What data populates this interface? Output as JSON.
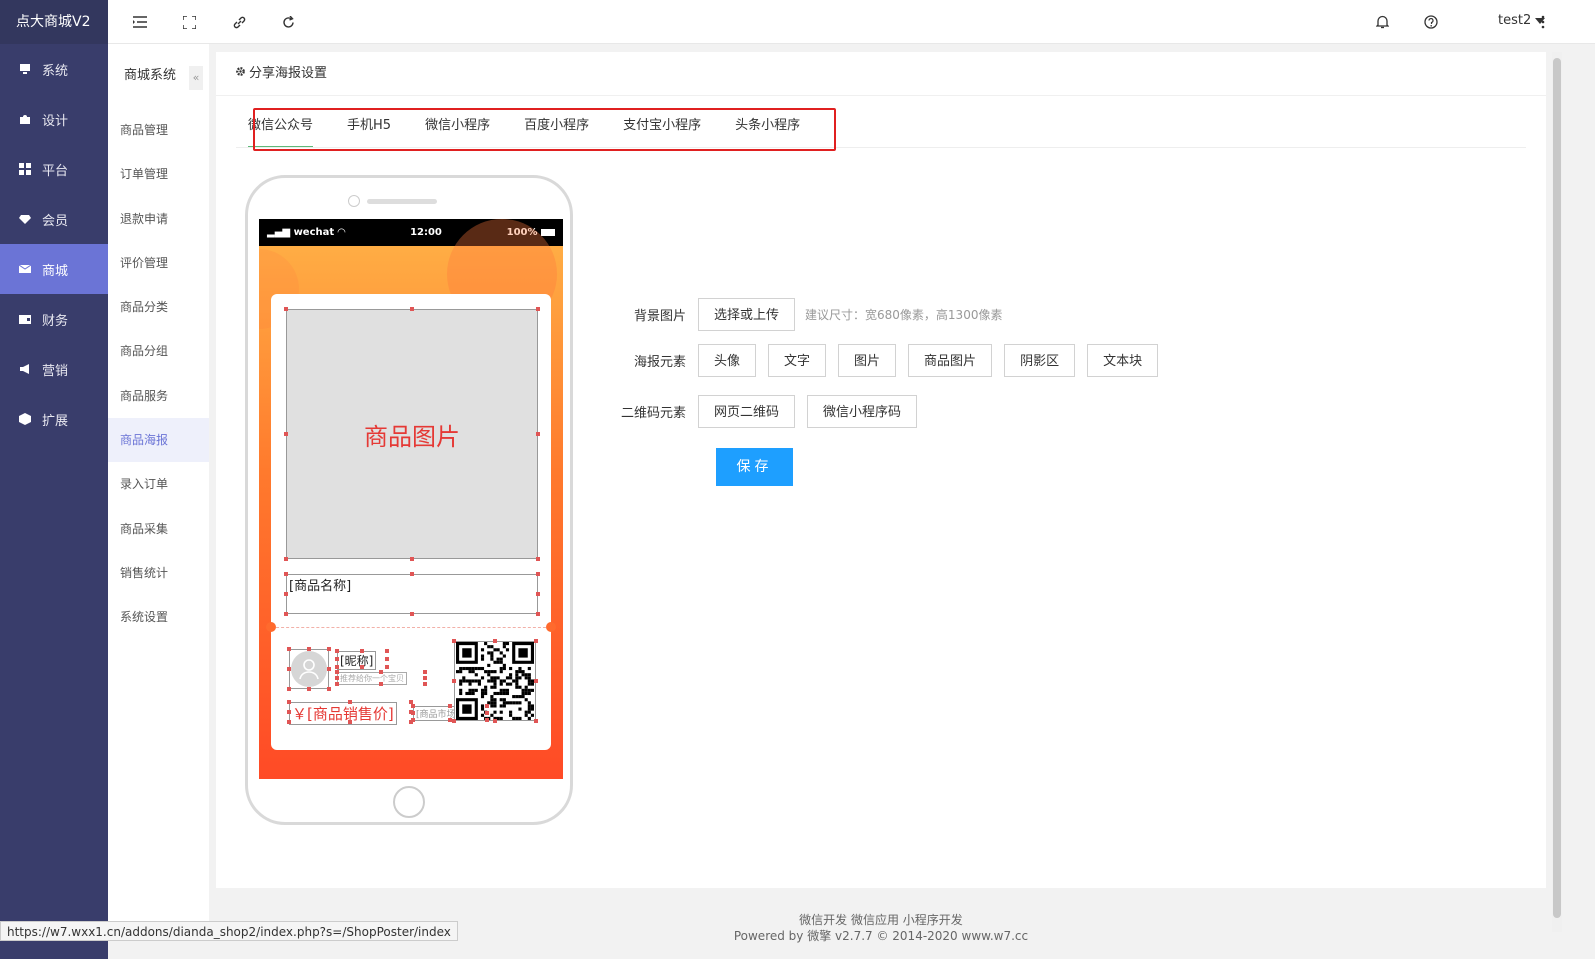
{
  "brand": "点大商城V2",
  "sidebar": {
    "items": [
      {
        "label": "系统",
        "icon": "monitor-icon"
      },
      {
        "label": "设计",
        "icon": "puzzle-icon"
      },
      {
        "label": "平台",
        "icon": "grid-icon"
      },
      {
        "label": "会员",
        "icon": "diamond-icon"
      },
      {
        "label": "商城",
        "icon": "mail-icon",
        "active": true
      },
      {
        "label": "财务",
        "icon": "wallet-icon"
      },
      {
        "label": "营销",
        "icon": "megaphone-icon"
      },
      {
        "label": "扩展",
        "icon": "cube-icon"
      }
    ]
  },
  "topbar": {
    "user": "test2"
  },
  "subnav": {
    "title": "商城系统",
    "collapse": "«",
    "items": [
      "商品管理",
      "订单管理",
      "退款申请",
      "评价管理",
      "商品分类",
      "商品分组",
      "商品服务",
      "商品海报",
      "录入订单",
      "商品采集",
      "销售统计",
      "系统设置"
    ],
    "active_index": 7
  },
  "panel": {
    "title": "分享海报设置",
    "tabs": [
      "微信公众号",
      "手机H5",
      "微信小程序",
      "百度小程序",
      "支付宝小程序",
      "头条小程序"
    ],
    "active_tab": 0
  },
  "phone": {
    "carrier": "wechat",
    "time": "12:00",
    "battery": "100%",
    "product_image": "商品图片",
    "product_name": "[商品名称]",
    "nickname": "[昵称]",
    "recommend": "推荐给你一个宝贝",
    "price": "￥[商品销售价]",
    "market_price": "[商品市场价]"
  },
  "form": {
    "bg_label": "背景图片",
    "bg_button": "选择或上传",
    "bg_hint": "建议尺寸：宽680像素，高1300像素",
    "elements_label": "海报元素",
    "elements": [
      "头像",
      "文字",
      "图片",
      "商品图片",
      "阴影区",
      "文本块"
    ],
    "qr_label": "二维码元素",
    "qr_buttons": [
      "网页二维码",
      "微信小程序码"
    ],
    "save": "保存"
  },
  "footer": {
    "line1": "微信开发 微信应用 小程序开发",
    "line2": "Powered by 微擎 v2.7.7 © 2014-2020 www.w7.cc"
  },
  "status_url": "https://w7.wxx1.cn/addons/dianda_shop2/index.php?s=/ShopPoster/index"
}
